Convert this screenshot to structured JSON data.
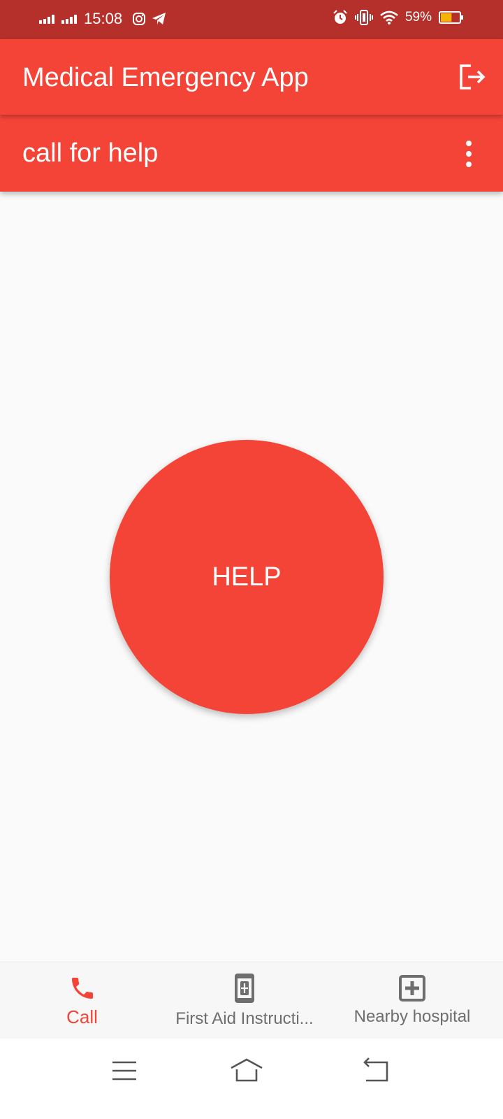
{
  "status_bar": {
    "time": "15:08",
    "battery_percent": "59%",
    "icons": [
      "signal-icon",
      "signal-icon",
      "instagram-icon",
      "telegram-icon",
      "alarm-icon",
      "vibrate-icon",
      "wifi-icon",
      "battery-icon"
    ],
    "battery_level": 0.59,
    "battery_color": "#f5b400"
  },
  "app_bar": {
    "title": "Medical Emergency App",
    "action_icon": "logout-icon"
  },
  "sub_bar": {
    "title": "call for help",
    "menu_icon": "more-vert-icon"
  },
  "main": {
    "help_label": "HELP"
  },
  "bottom_nav": {
    "items": [
      {
        "label": "Call",
        "icon": "phone-icon",
        "active": true
      },
      {
        "label": "First Aid Instructi...",
        "icon": "first-aid-phone-icon",
        "active": false
      },
      {
        "label": "Nearby hospital",
        "icon": "hospital-icon",
        "active": false
      }
    ]
  },
  "system_nav": {
    "icons": [
      "menu-icon",
      "home-icon",
      "back-icon"
    ]
  },
  "colors": {
    "primary": "#f44438",
    "status_bar": "#b5302a",
    "inactive": "#6e6e6e",
    "background": "#fafafa"
  }
}
